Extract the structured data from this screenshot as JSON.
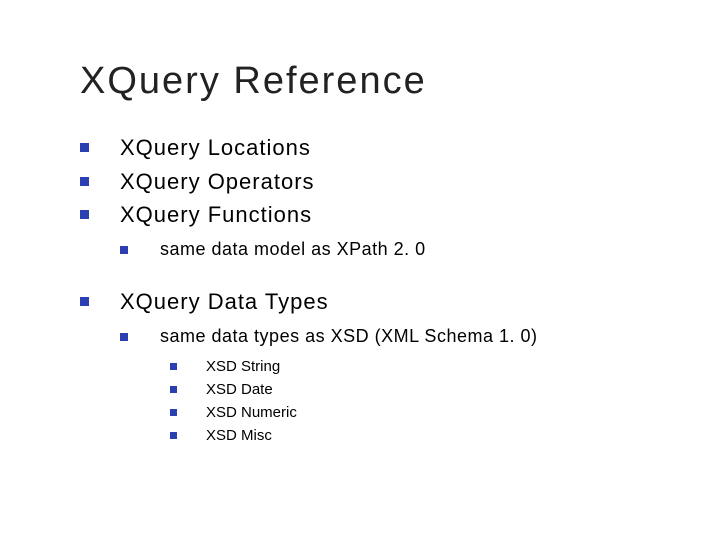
{
  "colors": {
    "bullet": "#2b3fb3",
    "text": "#000000",
    "background": "#ffffff"
  },
  "title": "XQuery Reference",
  "items": {
    "a": {
      "label": "XQuery Locations"
    },
    "b": {
      "label": "XQuery Operators"
    },
    "c": {
      "label": "XQuery Functions",
      "sub": {
        "a": {
          "label": "same data model as XPath 2. 0"
        }
      }
    },
    "d": {
      "label": "XQuery Data Types",
      "sub": {
        "a": {
          "label": "same data types as XSD (XML Schema 1. 0)",
          "sub": {
            "a": {
              "label": "XSD String"
            },
            "b": {
              "label": "XSD Date"
            },
            "c": {
              "label": "XSD Numeric"
            },
            "d": {
              "label": "XSD Misc"
            }
          }
        }
      }
    }
  }
}
